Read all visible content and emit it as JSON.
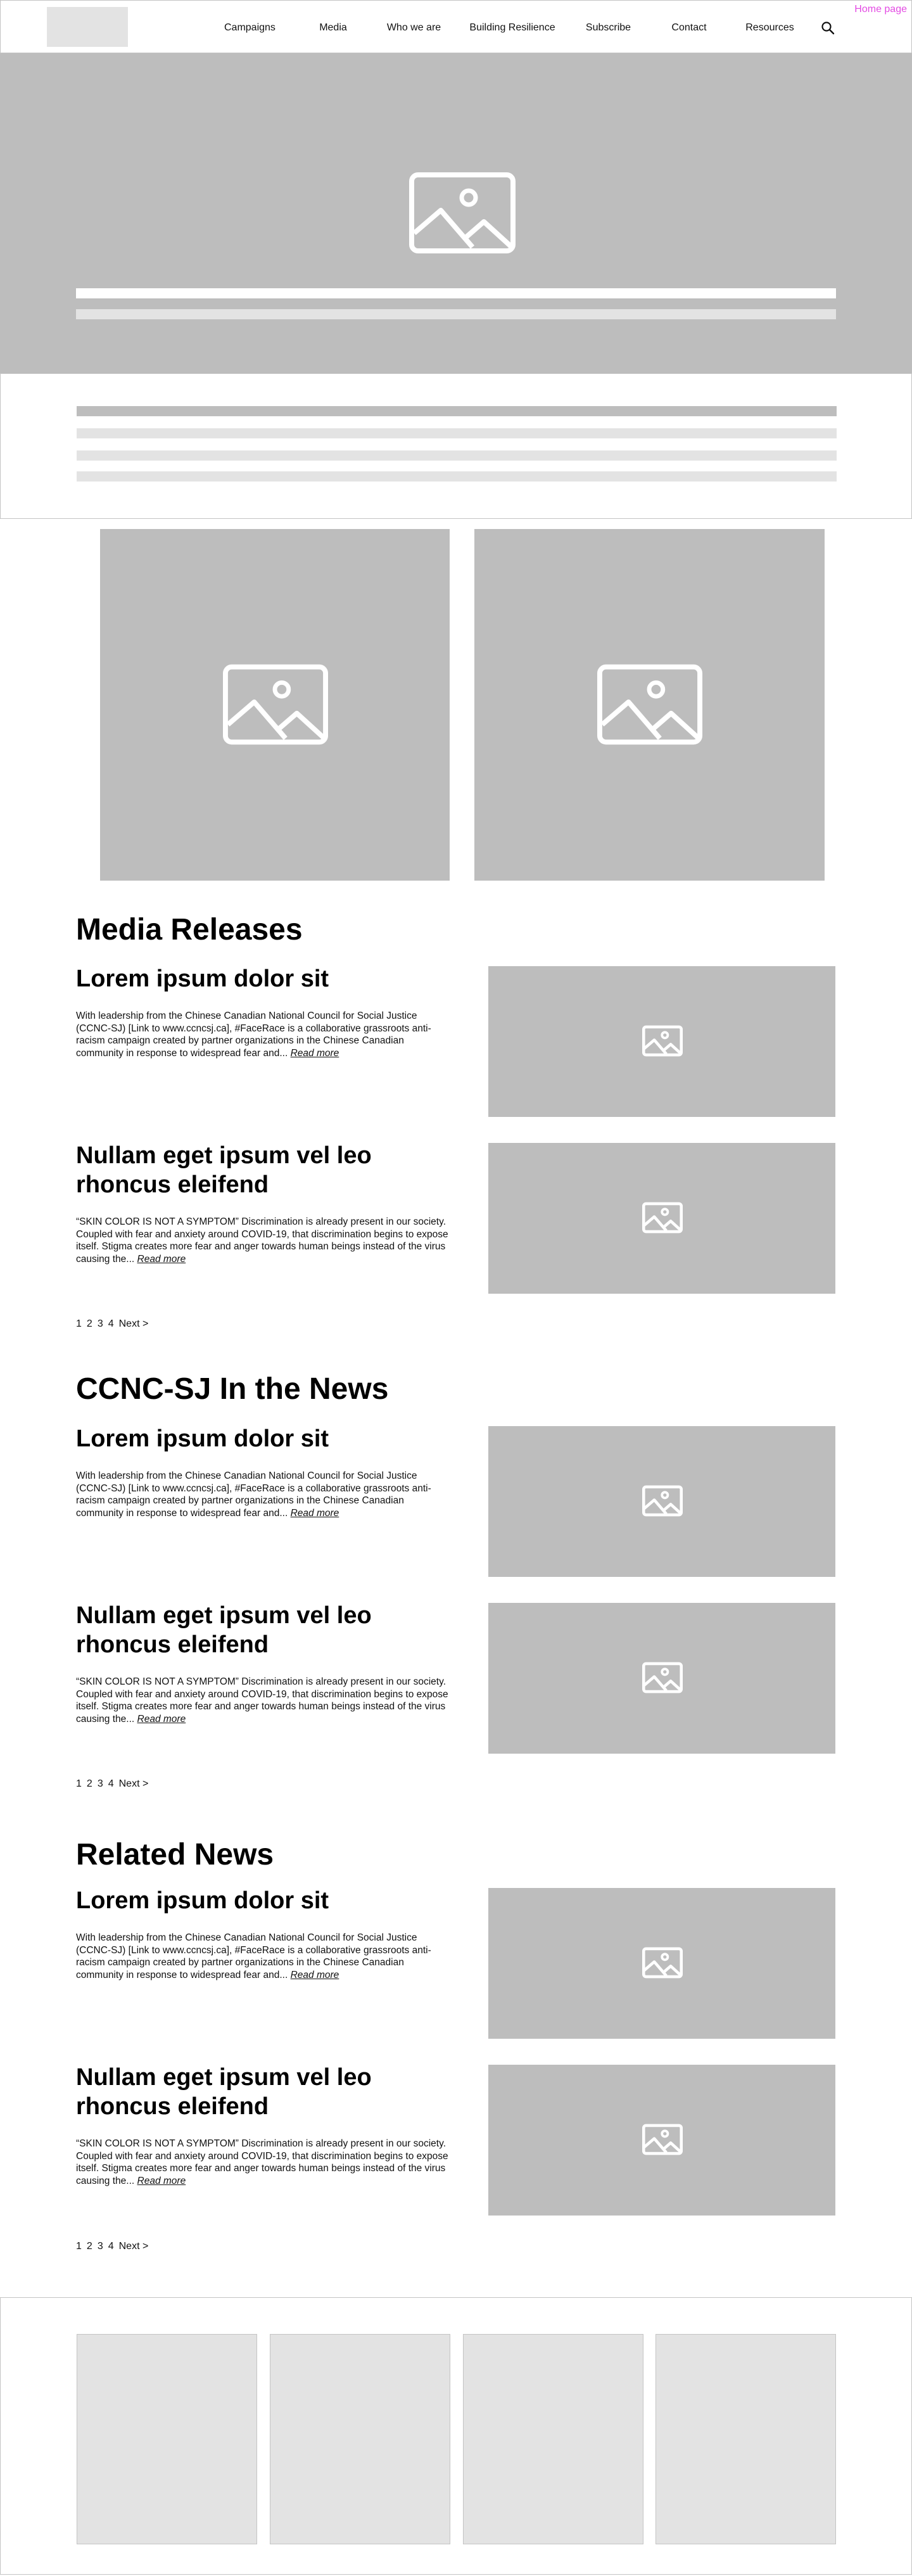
{
  "page_label": "Home page",
  "nav": {
    "items": [
      {
        "label": "Campaigns"
      },
      {
        "label": "Media"
      },
      {
        "label": "Who we are"
      },
      {
        "label": "Building Resilience"
      },
      {
        "label": "Subscribe"
      },
      {
        "label": "Contact"
      },
      {
        "label": "Resources"
      }
    ]
  },
  "icons": {
    "search": "search-icon",
    "image": "image-placeholder-icon"
  },
  "colors": {
    "placeholder_dark": "#bdbdbd",
    "placeholder_light": "#e3e3e3",
    "page_label": "#e34be3",
    "border": "#c4c4c4"
  },
  "sections": {
    "media_releases": {
      "title": "Media Releases",
      "articles": [
        {
          "title": "Lorem ipsum dolor sit",
          "body": "With leadership from the Chinese Canadian National Council for Social Justice (CCNC-SJ) [Link to www.ccncsj.ca], #FaceRace is a collaborative grassroots anti-racism campaign created by partner organizations in the Chinese Canadian community in response to widespread fear and...",
          "read_more": "Read more"
        },
        {
          "title": "Nullam eget ipsum vel leo rhoncus eleifend",
          "body": "“SKIN COLOR IS NOT A SYMPTOM” Discrimination is already present in our society. Coupled with fear and anxiety around COVID-19, that discrimination begins to expose itself. Stigma creates more fear and anger towards human beings instead of the virus causing the...",
          "read_more": "Read more"
        }
      ],
      "pagination": [
        "1",
        "2",
        "3",
        "4",
        "Next >"
      ]
    },
    "in_the_news": {
      "title": "CCNC-SJ In the News",
      "articles": [
        {
          "title": "Lorem ipsum dolor sit",
          "body": "With leadership from the Chinese Canadian National Council for Social Justice (CCNC-SJ) [Link to www.ccncsj.ca], #FaceRace is a collaborative grassroots anti-racism campaign created by partner organizations in the Chinese Canadian community in response to widespread fear and...",
          "read_more": "Read more"
        },
        {
          "title": "Nullam eget ipsum vel leo rhoncus eleifend",
          "body": "“SKIN COLOR IS NOT A SYMPTOM” Discrimination is already present in our society. Coupled with fear and anxiety around COVID-19, that discrimination begins to expose itself. Stigma creates more fear and anger towards human beings instead of the virus causing the...",
          "read_more": "Read more"
        }
      ],
      "pagination": [
        "1",
        "2",
        "3",
        "4",
        "Next >"
      ]
    },
    "related_news": {
      "title": "Related News",
      "articles": [
        {
          "title": "Lorem ipsum dolor sit",
          "body": "With leadership from the Chinese Canadian National Council for Social Justice (CCNC-SJ) [Link to www.ccncsj.ca], #FaceRace is a collaborative grassroots anti-racism campaign created by partner organizations in the Chinese Canadian community in response to widespread fear and...",
          "read_more": "Read more"
        },
        {
          "title": "Nullam eget ipsum vel leo rhoncus eleifend",
          "body": "“SKIN COLOR IS NOT A SYMPTOM” Discrimination is already present in our society. Coupled with fear and anxiety around COVID-19, that discrimination begins to expose itself. Stigma creates more fear and anger towards human beings instead of the virus causing the...",
          "read_more": "Read more"
        }
      ],
      "pagination": [
        "1",
        "2",
        "3",
        "4",
        "Next >"
      ]
    }
  }
}
